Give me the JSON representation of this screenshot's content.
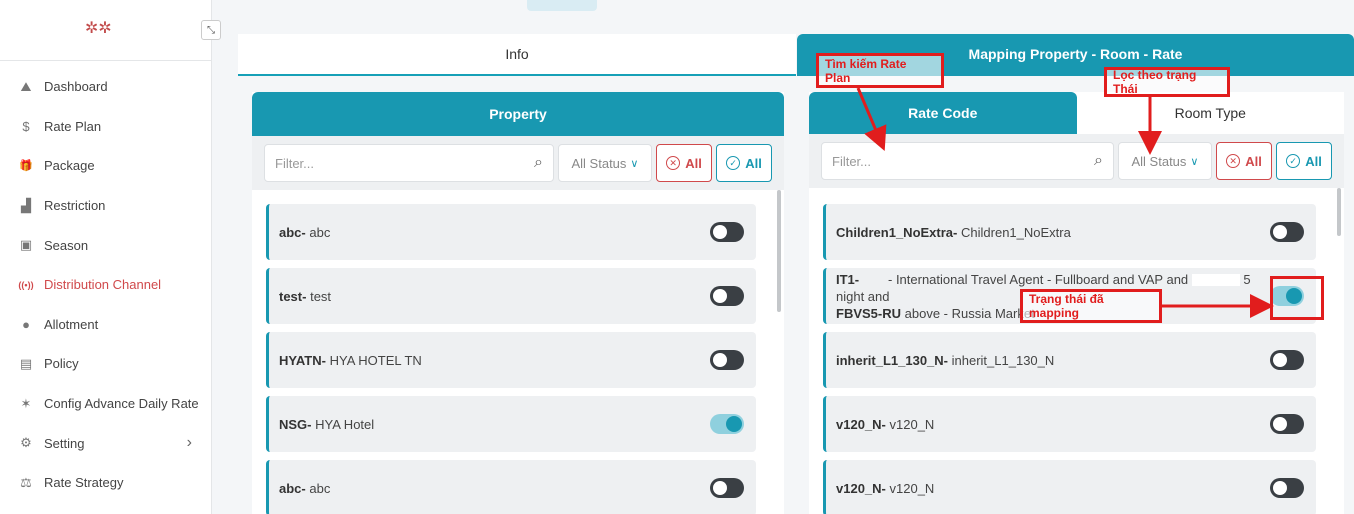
{
  "sidebar": {
    "logo_icon": "hya-logo-icon",
    "items": [
      {
        "label": "Dashboard",
        "icon": "dashboard-icon",
        "glyph": "⛰"
      },
      {
        "label": "Rate Plan",
        "icon": "dollar-icon",
        "glyph": "$"
      },
      {
        "label": "Package",
        "icon": "gift-icon",
        "glyph": "🎁"
      },
      {
        "label": "Restriction",
        "icon": "restriction-icon",
        "glyph": "▟"
      },
      {
        "label": "Season",
        "icon": "calendar-icon",
        "glyph": "▣"
      },
      {
        "label": "Distribution Channel",
        "icon": "broadcast-icon",
        "glyph": "((•))",
        "active": true
      },
      {
        "label": "Allotment",
        "icon": "users-icon",
        "glyph": "●"
      },
      {
        "label": "Policy",
        "icon": "document-icon",
        "glyph": "▤"
      },
      {
        "label": "Config Advance Daily Rate",
        "icon": "config-icon",
        "glyph": "✶"
      },
      {
        "label": "Setting",
        "icon": "gear-icon",
        "glyph": "⚙",
        "has_submenu": true
      },
      {
        "label": "Rate Strategy",
        "icon": "strategy-icon",
        "glyph": "⚖"
      }
    ]
  },
  "tabs": {
    "info": "Info",
    "mapping": "Mapping Property - Room - Rate"
  },
  "left_panel": {
    "title": "Property",
    "filter_placeholder": "Filter...",
    "status": "All Status",
    "btn_uncheck": "All",
    "btn_check": "All",
    "rows": [
      {
        "code": "abc",
        "name": "abc",
        "enabled": false
      },
      {
        "code": "test",
        "name": "test",
        "enabled": false
      },
      {
        "code": "HYATN",
        "name": "HYA HOTEL TN",
        "enabled": false
      },
      {
        "code": "NSG",
        "name": "HYA Hotel",
        "enabled": true
      },
      {
        "code": "abc",
        "name": "abc",
        "enabled": false
      }
    ]
  },
  "right_panel": {
    "tab_rate_code": "Rate Code",
    "tab_room_type": "Room Type",
    "filter_placeholder": "Filter...",
    "status": "All Status",
    "btn_uncheck": "All",
    "btn_check": "All",
    "rows": [
      {
        "code": "Children1_NoExtra",
        "name": "Children1_NoExtra",
        "enabled": false
      },
      {
        "code_line1": "IT1-",
        "code_line2": "FBVS5-RU",
        "name_line1": "- International Travel Agent - Fullboard and VAP and",
        "name_mid": "5 night and",
        "name_line2": "above - Russia Market",
        "enabled": true
      },
      {
        "code": "inherit_L1_130_N",
        "name": "inherit_L1_130_N",
        "enabled": false
      },
      {
        "code": "v120_N",
        "name": "v120_N",
        "enabled": false
      },
      {
        "code": "v120_N",
        "name": "v120_N",
        "enabled": false
      }
    ]
  },
  "annotations": {
    "search_rate_plan": "Tìm kiếm Rate Plan",
    "filter_status": "Lọc theo trạng Thái",
    "mapped_status": "Trạng thái đã mapping",
    "color": "#e11d1d"
  }
}
